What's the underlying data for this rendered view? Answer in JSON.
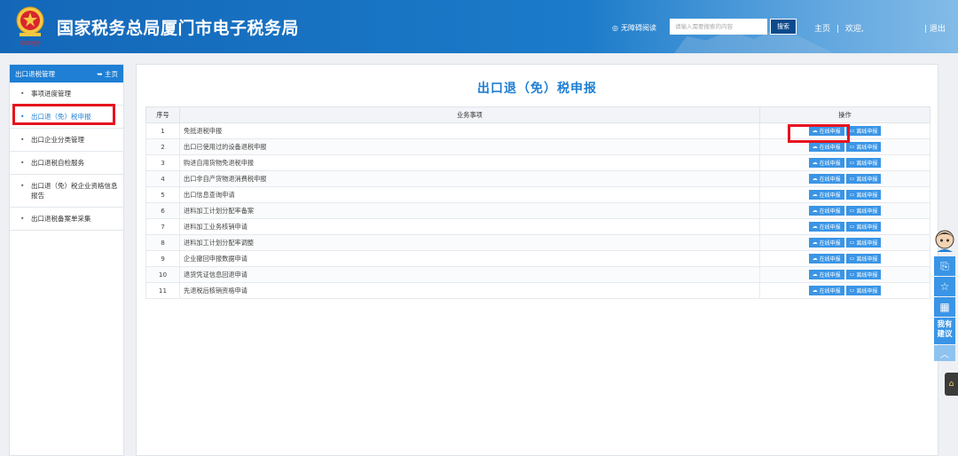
{
  "header": {
    "title": "国家税务总局厦门市电子税务局",
    "emblem_text": "中国税务",
    "accessibility": "无障碍阅读",
    "search_placeholder": "请输入需要搜索的内容",
    "search_button": "搜索",
    "home_link": "主页",
    "separator": "|",
    "welcome": "欢迎,",
    "logout": "| 退出"
  },
  "sidebar": {
    "heading": "出口退税管理",
    "home_link": "主页",
    "items": [
      {
        "label": "事项进度管理"
      },
      {
        "label": "出口退（免）税申报"
      },
      {
        "label": "出口企业分类管理"
      },
      {
        "label": "出口退税自检服务"
      },
      {
        "label": "出口退（免）税企业资格信息报告"
      },
      {
        "label": "出口退税备案单采集"
      }
    ],
    "active_index": 1
  },
  "main": {
    "title": "出口退（免）税申报",
    "table": {
      "headers": [
        "序号",
        "业务事项",
        "操作"
      ],
      "online_label": "在线申报",
      "offline_label": "离线申报",
      "rows": [
        {
          "num": "1",
          "name": "免抵退税申报"
        },
        {
          "num": "2",
          "name": "出口已使用过的设备退税申报"
        },
        {
          "num": "3",
          "name": "购进自用货物免退税申报"
        },
        {
          "num": "4",
          "name": "出口非自产货物退消费税申报"
        },
        {
          "num": "5",
          "name": "出口信息查询申请"
        },
        {
          "num": "6",
          "name": "进料加工计划分配率备案"
        },
        {
          "num": "7",
          "name": "进料加工业务核销申请"
        },
        {
          "num": "8",
          "name": "进料加工计划分配率调整"
        },
        {
          "num": "9",
          "name": "企业撤回申报数据申请"
        },
        {
          "num": "10",
          "name": "退货凭证信息回退申请"
        },
        {
          "num": "11",
          "name": "先退税后核销资格申请"
        }
      ]
    }
  },
  "floatbar": {
    "suggest": "我有建议"
  },
  "colors": {
    "brand": "#1e7fd4",
    "button": "#3a95e6",
    "highlight": "#e5141f"
  }
}
